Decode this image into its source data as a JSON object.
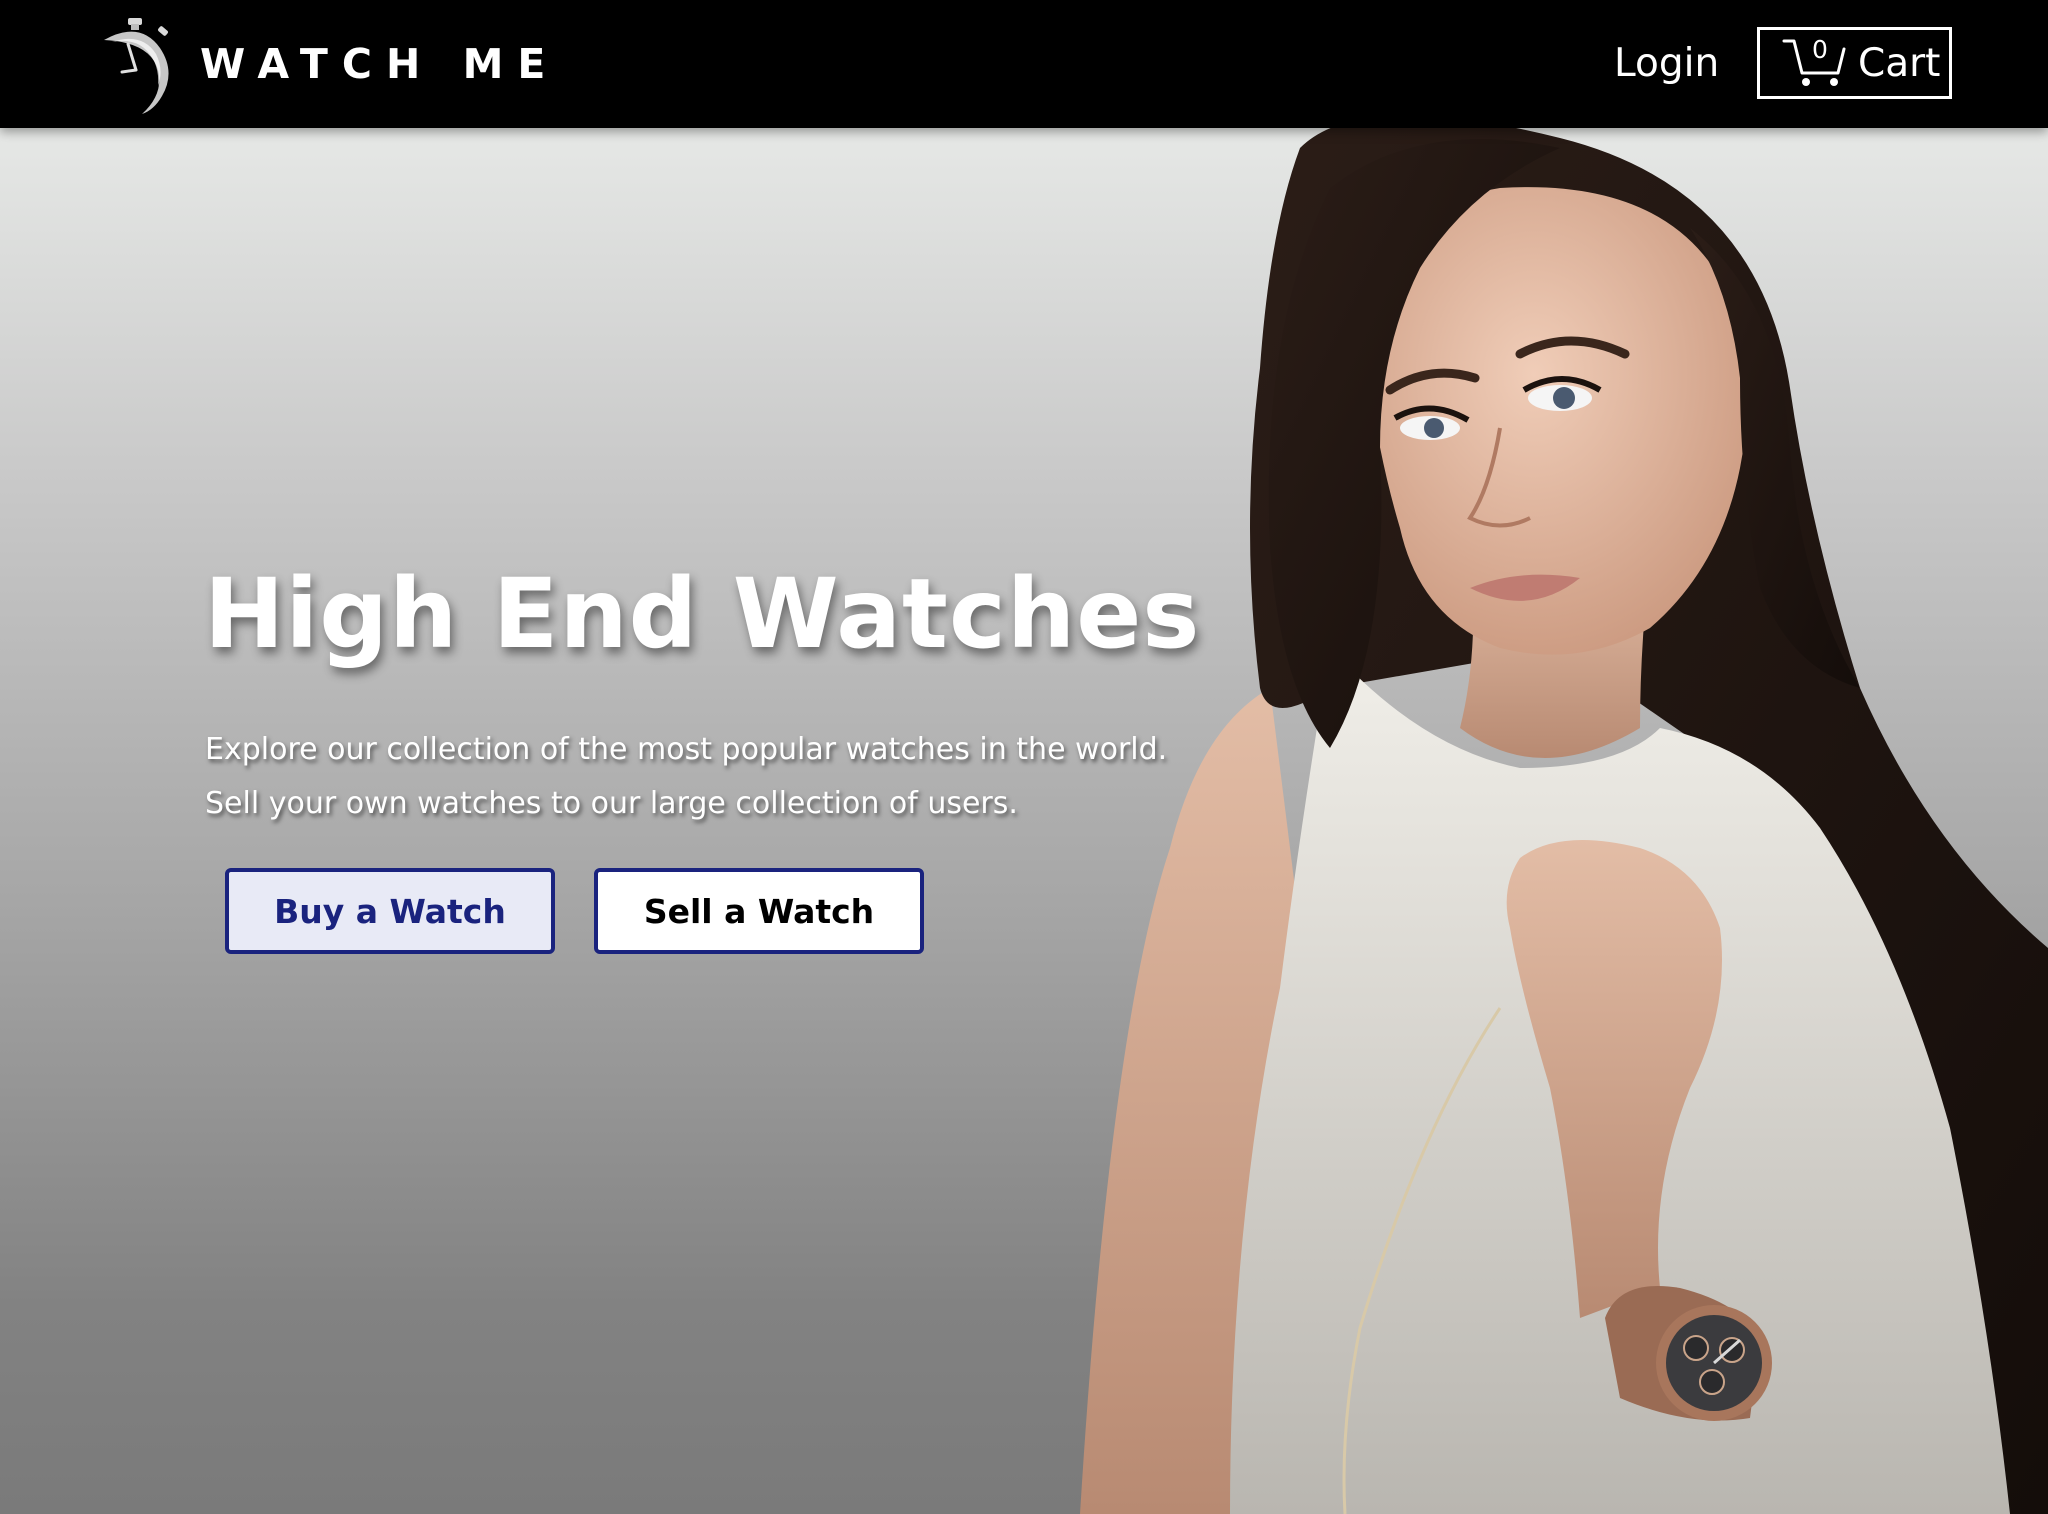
{
  "navbar": {
    "brand_name": "WATCH ME",
    "login_label": "Login",
    "cart_label": "Cart",
    "cart_count": "0"
  },
  "hero": {
    "title": "High End Watches",
    "description_line_1": "Explore our collection of the most popular watches in the world.",
    "description_line_2": "Sell your own watches to our large collection of users.",
    "buy_button_label": "Buy a Watch",
    "sell_button_label": "Sell a Watch"
  },
  "colors": {
    "navbar_bg": "#000000",
    "button_border": "#1a237e",
    "buy_button_bg": "#e8eaf6",
    "buy_button_text": "#1a237e",
    "sell_button_bg": "#ffffff"
  },
  "icons": {
    "brand_logo": "stopwatch-icon",
    "cart_icon": "shopping-cart-icon"
  }
}
